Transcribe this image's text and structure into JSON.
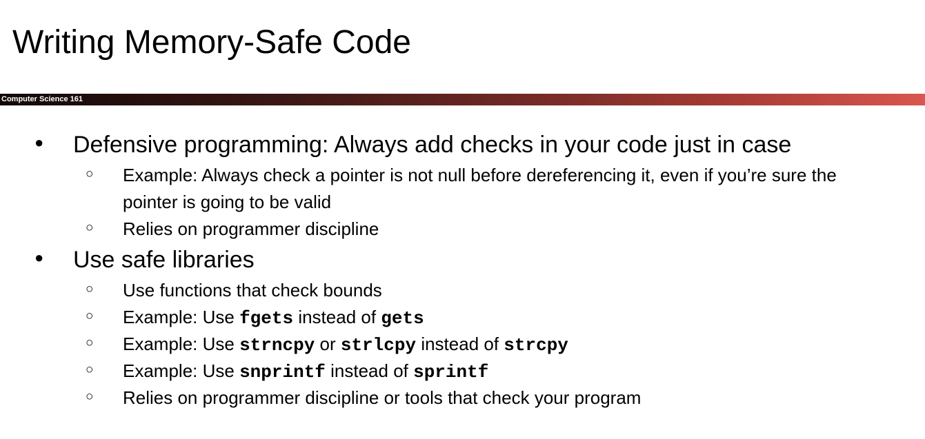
{
  "slide": {
    "title": "Writing Memory-Safe Code",
    "course_label": "Computer Science 161"
  },
  "bullets": {
    "b1": {
      "marker": "●",
      "text": "Defensive programming: Always add checks in your code just in case",
      "subs": {
        "s1": {
          "marker": "○",
          "line1": "Example: Always check a pointer is not null before dereferencing it, even if you’re sure the",
          "line2": "pointer is going to be valid"
        },
        "s2": {
          "marker": "○",
          "text": "Relies on programmer discipline"
        }
      }
    },
    "b2": {
      "marker": "●",
      "text": "Use safe libraries",
      "subs": {
        "s1": {
          "marker": "○",
          "text": "Use functions that check bounds"
        },
        "s2": {
          "marker": "○",
          "pre": "Example: Use ",
          "code1": "fgets",
          "mid": " instead of ",
          "code2": "gets"
        },
        "s3": {
          "marker": "○",
          "pre": "Example: Use ",
          "code1": "strncpy",
          "or": " or ",
          "code2": "strlcpy",
          "mid": " instead of ",
          "code3": "strcpy"
        },
        "s4": {
          "marker": "○",
          "pre": "Example: Use ",
          "code1": "snprintf",
          "mid": " instead of ",
          "code2": "sprintf"
        },
        "s5": {
          "marker": "○",
          "text": "Relies on programmer discipline or tools that check your program"
        }
      }
    }
  }
}
